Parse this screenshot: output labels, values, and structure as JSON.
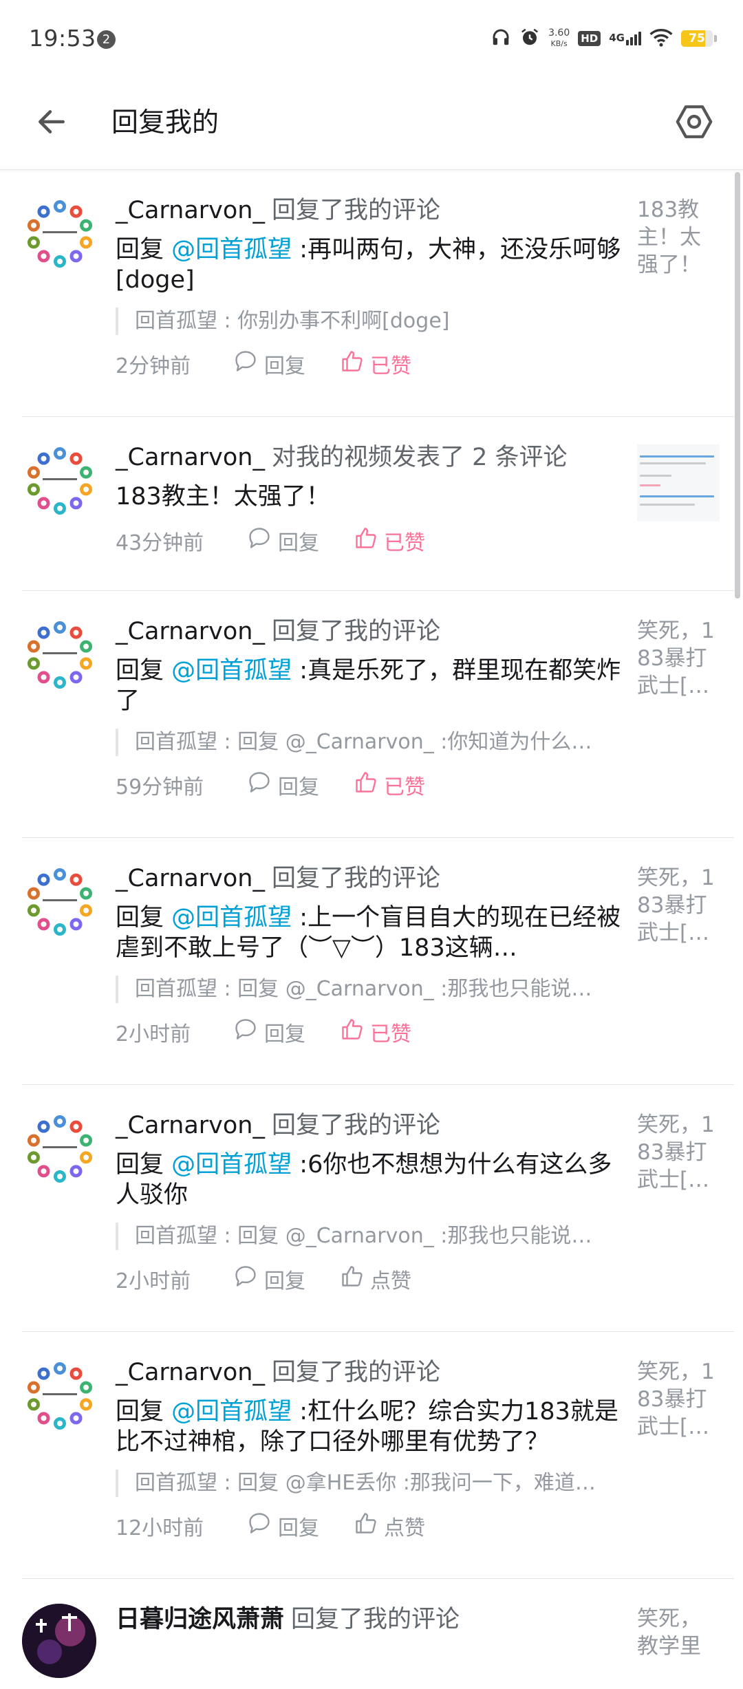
{
  "status_bar": {
    "time": "19:53",
    "notification_count": "2",
    "net_speed_value": "3.60",
    "net_speed_unit": "KB/s",
    "hd_label": "HD",
    "network_label": "4G",
    "battery_level": "75",
    "battery_fraction": 0.75
  },
  "header": {
    "title": "回复我的"
  },
  "items": [
    {
      "username": "_Carnarvon_",
      "action": "回复了我的评论",
      "reply_prefix": "回复 ",
      "mention": "@回首孤望",
      "text": " :再叫两句，大神，还没乐呵够[doge]",
      "quote": "回首孤望 : 你别办事不利啊[doge]",
      "time": "2分钟前",
      "reply_label": "回复",
      "like_label": "已赞",
      "liked": true,
      "thumb_text": "183教主！太强了！"
    },
    {
      "username": "_Carnarvon_",
      "action": "对我的视频发表了 2 条评论",
      "text": "183教主！太强了！",
      "time": "43分钟前",
      "reply_label": "回复",
      "like_label": "已赞",
      "liked": true
    },
    {
      "username": "_Carnarvon_",
      "action": "回复了我的评论",
      "reply_prefix": "回复 ",
      "mention": "@回首孤望",
      "text": " :真是乐死了，群里现在都笑炸了",
      "quote": "回首孤望 : 回复 @_Carnarvon_ :你知道为什么…",
      "time": "59分钟前",
      "reply_label": "回复",
      "like_label": "已赞",
      "liked": true,
      "thumb_text": "笑死，183暴打武士[…"
    },
    {
      "username": "_Carnarvon_",
      "action": "回复了我的评论",
      "reply_prefix": "回复 ",
      "mention": "@回首孤望",
      "text": " :上一个盲目自大的现在已经被虐到不敢上号了（︶▽︶）183这辆…",
      "quote": "回首孤望 : 回复 @_Carnarvon_ :那我也只能说…",
      "time": "2小时前",
      "reply_label": "回复",
      "like_label": "已赞",
      "liked": true,
      "thumb_text": "笑死，183暴打武士[…"
    },
    {
      "username": "_Carnarvon_",
      "action": "回复了我的评论",
      "reply_prefix": "回复 ",
      "mention": "@回首孤望",
      "text": " :6你也不想想为什么有这么多人驳你",
      "quote": "回首孤望 : 回复 @_Carnarvon_ :那我也只能说…",
      "time": "2小时前",
      "reply_label": "回复",
      "like_label": "点赞",
      "liked": false,
      "thumb_text": "笑死，183暴打武士[…"
    },
    {
      "username": "_Carnarvon_",
      "action": "回复了我的评论",
      "reply_prefix": "回复 ",
      "mention": "@回首孤望",
      "text": " :杠什么呢？综合实力183就是比不过神棺，除了口径外哪里有优势了？",
      "quote": "回首孤望 : 回复 @拿HE丢你 :那我问一下，难道…",
      "time": "12小时前",
      "reply_label": "回复",
      "like_label": "点赞",
      "liked": false,
      "thumb_text": "笑死，183暴打武士[…"
    },
    {
      "username": "日暮归途风萧萧",
      "action": "回复了我的评论",
      "thumb_text": "笑死，教学里"
    }
  ],
  "colors": {
    "mention": "#00a1d6",
    "liked": "#fb7299",
    "secondary_text": "#9499a0",
    "battery": "#f5c518"
  }
}
